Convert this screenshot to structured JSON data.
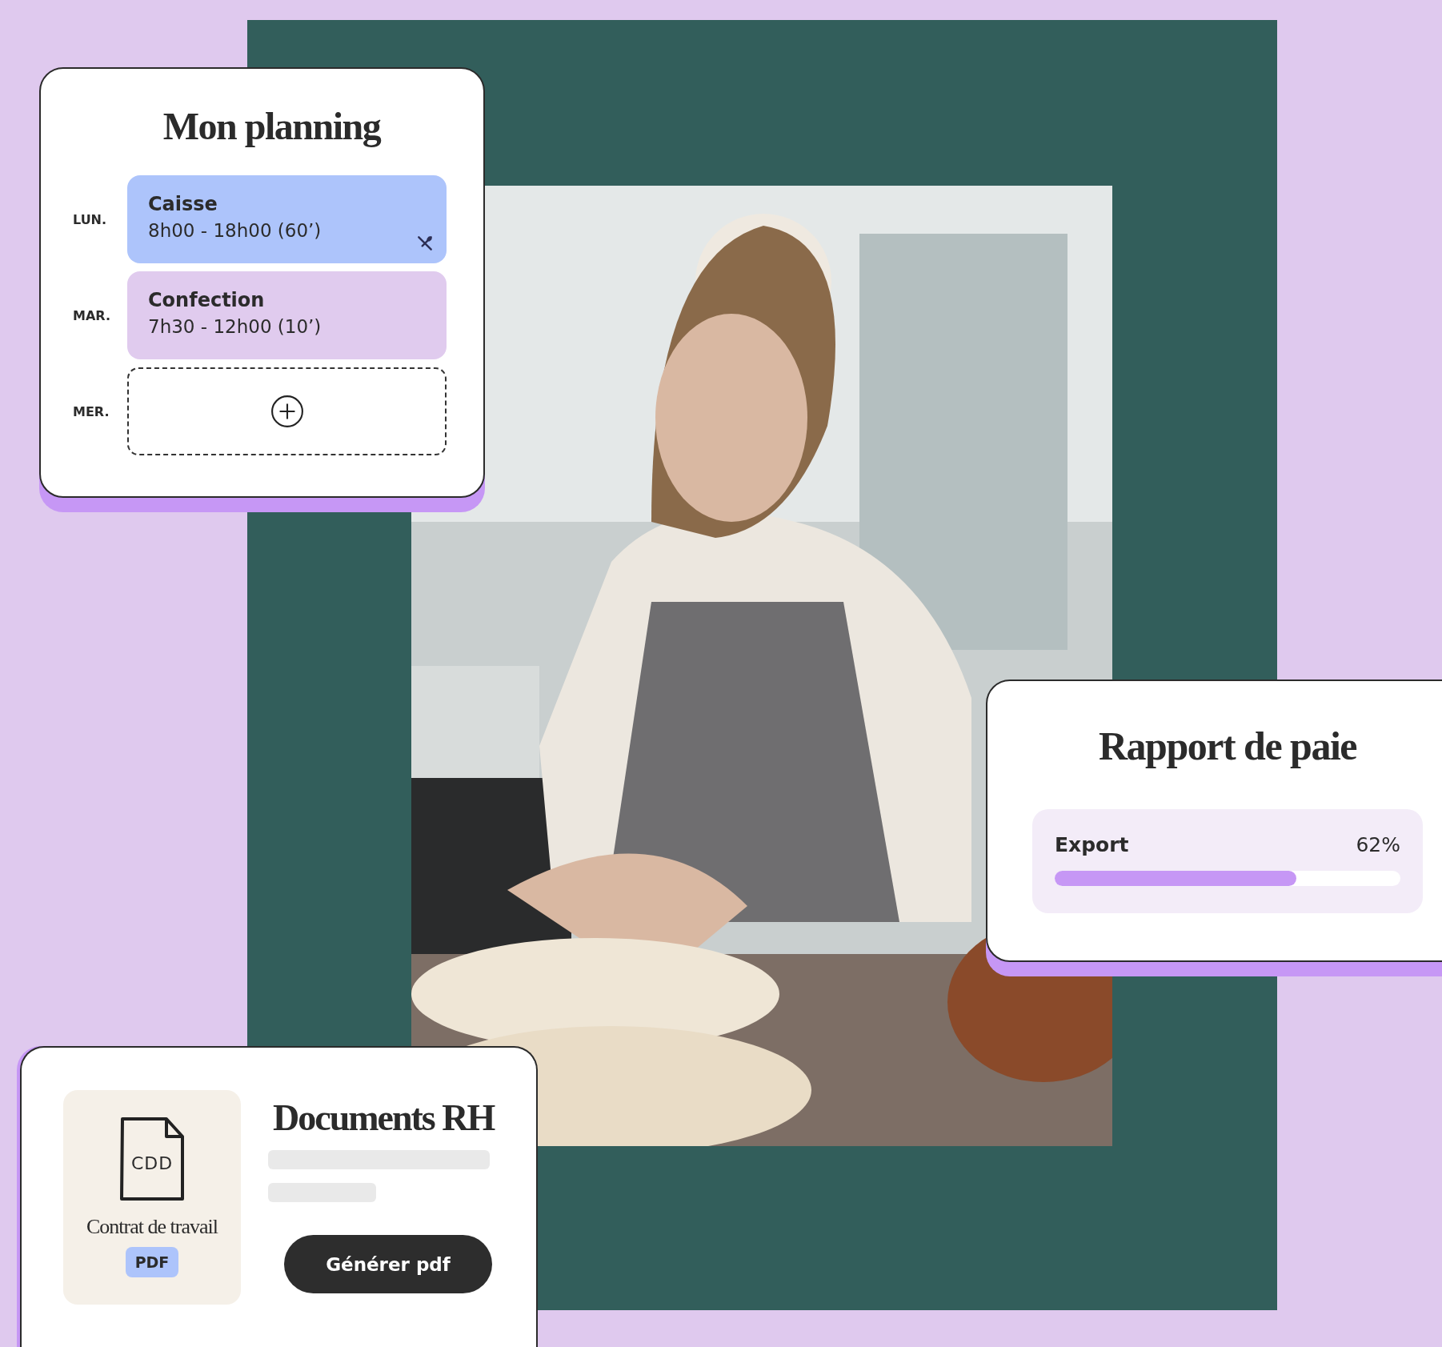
{
  "planning": {
    "title": "Mon planning",
    "days": [
      {
        "day": "LUN.",
        "kind": "shift",
        "title": "Caisse",
        "time": "8h00 - 18h00 (60’)",
        "color": "#adc4fb",
        "meal_break": true
      },
      {
        "day": "MAR.",
        "kind": "shift",
        "title": "Confection",
        "time": "7h30 - 12h00 (10’)",
        "color": "#e0cbee",
        "meal_break": false
      },
      {
        "day": "MER.",
        "kind": "empty"
      }
    ]
  },
  "payroll": {
    "title": "Rapport de paie",
    "task": "Export",
    "reading": "62%",
    "level": 0.7
  },
  "documents": {
    "title": "Documents RH",
    "file_icon_text": "CDD",
    "file_name": "Contrat de travail",
    "file_type": "PDF",
    "button": "Générer pdf"
  }
}
